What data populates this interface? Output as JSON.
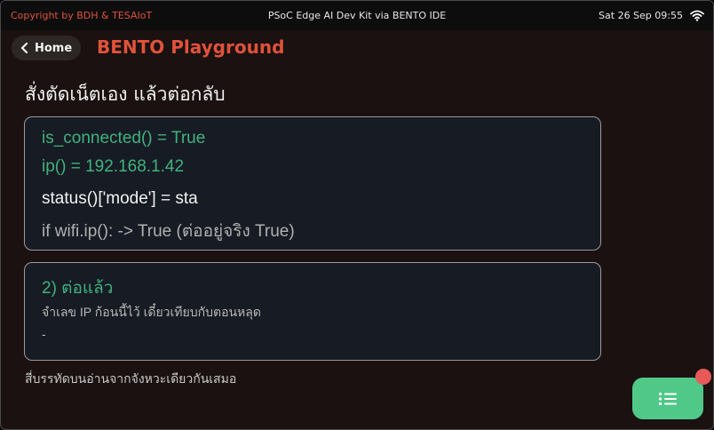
{
  "statusbar": {
    "copyright": "Copyright by BDH & TESAIoT",
    "device": "PSoC Edge AI Dev Kit via BENTO IDE",
    "clock": "Sat 26 Sep 09:55",
    "wifi_icon": "wifi-icon"
  },
  "header": {
    "home_label": "Home",
    "app_title": "BENTO Playground"
  },
  "page": {
    "title": "สั่งตัดเน็ตเอง แล้วต่อกลับ"
  },
  "card1": {
    "lines": [
      "is_connected() = True",
      "ip() = 192.168.1.42",
      "status()['mode'] = sta",
      "if wifi.ip(): -> True   (ต่ออยู่จริง True)"
    ]
  },
  "card2": {
    "title": "2) ต่อแล้ว",
    "description": "จำเลข IP ก้อนนี้ไว้ เดี๋ยวเทียบกับตอนหลุด",
    "value": "-"
  },
  "footer": {
    "note": "สี่บรรทัดบนอ่านจากจังหวะเดียวกันเสมอ"
  },
  "colors": {
    "accent": "#e0523a",
    "success": "#3fb27f",
    "fab": "#4fc888",
    "badge": "#e65a5a"
  }
}
